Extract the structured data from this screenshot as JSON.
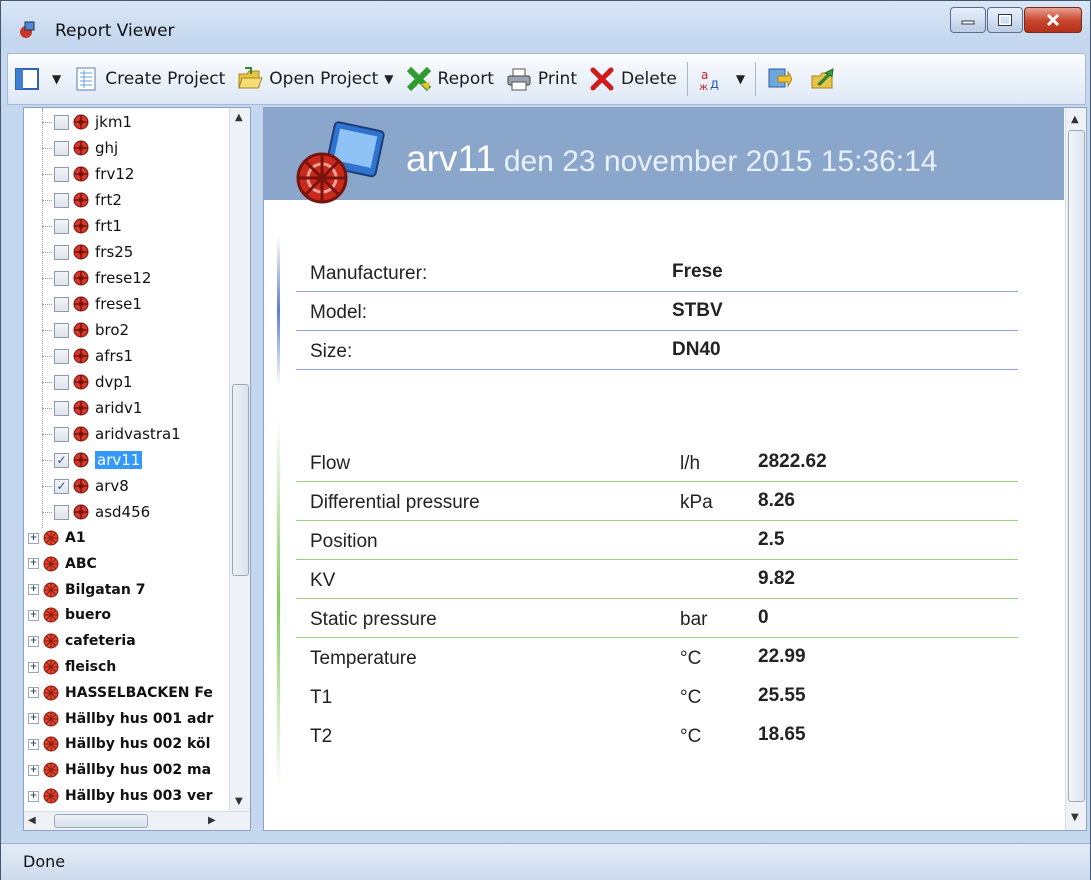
{
  "window": {
    "title": "Report Viewer"
  },
  "toolbar": {
    "create_project": "Create Project",
    "open_project": "Open Project",
    "report": "Report",
    "print": "Print",
    "delete": "Delete"
  },
  "tree": {
    "children": [
      {
        "label": "jkm1",
        "checked": false
      },
      {
        "label": "ghj",
        "checked": false
      },
      {
        "label": "frv12",
        "checked": false
      },
      {
        "label": "frt2",
        "checked": false
      },
      {
        "label": "frt1",
        "checked": false
      },
      {
        "label": "frs25",
        "checked": false
      },
      {
        "label": "frese12",
        "checked": false
      },
      {
        "label": "frese1",
        "checked": false
      },
      {
        "label": "bro2",
        "checked": false
      },
      {
        "label": "afrs1",
        "checked": false
      },
      {
        "label": "dvp1",
        "checked": false
      },
      {
        "label": "aridv1",
        "checked": false
      },
      {
        "label": "aridvastra1",
        "checked": false
      },
      {
        "label": "arv11",
        "checked": true,
        "selected": true
      },
      {
        "label": "arv8",
        "checked": true
      },
      {
        "label": "asd456",
        "checked": false
      }
    ],
    "groups": [
      "A1",
      "ABC",
      "Bilgatan 7",
      "buero",
      "cafeteria",
      "fleisch",
      "HASSELBACKEN Fe",
      "Hällby hus 001 adr",
      "Hällby hus 002 köl",
      "Hällby hus 002 ma",
      "Hällby hus 003 ver"
    ]
  },
  "report": {
    "title": "arv11",
    "date": "den 23 november 2015 15:36:14",
    "info": [
      {
        "label": "Manufacturer:",
        "value": "Frese"
      },
      {
        "label": "Model:",
        "value": "STBV"
      },
      {
        "label": "Size:",
        "value": "DN40"
      }
    ],
    "measurements": [
      {
        "label": "Flow",
        "unit": "l/h",
        "value": "2822.62"
      },
      {
        "label": "Differential pressure",
        "unit": "kPa",
        "value": "8.26"
      },
      {
        "label": "Position",
        "unit": "",
        "value": "2.5"
      },
      {
        "label": "KV",
        "unit": "",
        "value": "9.82"
      },
      {
        "label": "Static pressure",
        "unit": "bar",
        "value": "0"
      },
      {
        "label": "Temperature",
        "unit": "°C",
        "value": "22.99"
      },
      {
        "label": "T1",
        "unit": "°C",
        "value": "25.55"
      },
      {
        "label": "T2",
        "unit": "°C",
        "value": "18.65"
      }
    ]
  },
  "status": {
    "text": "Done"
  }
}
